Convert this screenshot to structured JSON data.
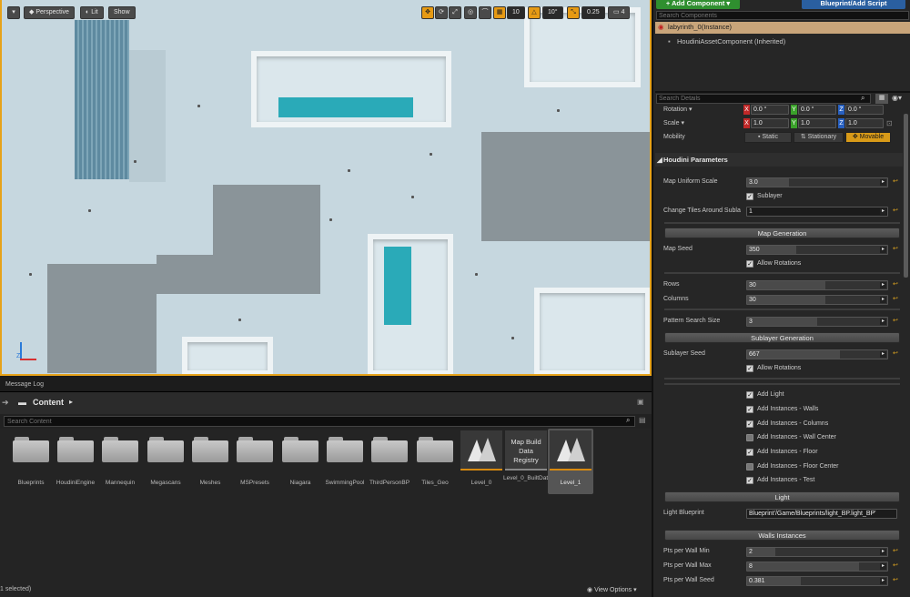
{
  "viewport": {
    "perspective_label": "Perspective",
    "lit_label": "Lit",
    "show_label": "Show",
    "grid_snap": "10",
    "rot_snap": "10°",
    "scale_snap": "0.25",
    "camera_speed": "4"
  },
  "bottom": {
    "message_log": "Message Log",
    "content_label": "Content",
    "search_placeholder": "Search Content",
    "status": "1 selected)",
    "view_options": "View Options",
    "folders": [
      "Blueprints",
      "HoudiniEngine",
      "Mannequin",
      "Megascans",
      "Meshes",
      "MSPresets",
      "Niagara",
      "SwimmingPool",
      "ThirdPersonBP",
      "Tiles_Geo"
    ],
    "assets": [
      {
        "label": "Level_0",
        "kind": "level"
      },
      {
        "label": "Level_0_BuiltData",
        "tile_text": "Map Build Data Registry",
        "kind": "data"
      },
      {
        "label": "Level_1",
        "kind": "level"
      }
    ]
  },
  "details": {
    "add_component": "+ Add Component ▾",
    "blueprint_script": "Blueprint/Add Script",
    "search_components": "Search Components",
    "instance_name": "labyrinth_0(Instance)",
    "houdini_component": "HoudiniAssetComponent (Inherited)",
    "search_details": "Search Details",
    "rotation_label": "Rotation ▾",
    "rotation": [
      "0.0 °",
      "0.0 °",
      "0.0 °"
    ],
    "scale_label": "Scale ▾",
    "scale": [
      "1.0",
      "1.0",
      "1.0"
    ],
    "mobility_label": "Mobility",
    "mobility": [
      "Static",
      "Stationary",
      "Movable"
    ],
    "houdini_header": "Houdini Parameters",
    "params": {
      "map_uniform_scale_label": "Map Uniform Scale",
      "map_uniform_scale": "3.0",
      "sublayer_label": "Sublayer",
      "change_tiles_label": "Change Tiles Around Subla",
      "change_tiles_value": "1",
      "map_generation": "Map Generation",
      "map_seed_label": "Map Seed",
      "map_seed": "350",
      "allow_rotations": "Allow Rotations",
      "rows_label": "Rows",
      "rows": "30",
      "columns_label": "Columns",
      "columns": "30",
      "pattern_label": "Pattern Search Size",
      "pattern": "3",
      "sublayer_generation": "Sublayer Generation",
      "sublayer_seed_label": "Sublayer Seed",
      "sublayer_seed": "667",
      "allow_rotations_2": "Allow Rotations",
      "add_light": "Add Light",
      "add_walls": "Add Instances - Walls",
      "add_columns": "Add Instances - Columns",
      "add_wall_center": "Add Instances - Wall Center",
      "add_floor": "Add Instances - Floor",
      "add_floor_center": "Add Instances - Floor Center",
      "add_test": "Add Instances - Test",
      "light_header": "Light",
      "light_bp_label": "Light Blueprint",
      "light_bp": "Blueprint'/Game/Blueprints/light_BP.light_BP'",
      "walls_header": "Walls Instances",
      "pts_min_label": "Pts per Wall Min",
      "pts_min": "2",
      "pts_max_label": "Pts per Wall Max",
      "pts_max": "8",
      "pts_seed_label": "Pts per Wall Seed",
      "pts_seed": "0.381"
    }
  }
}
